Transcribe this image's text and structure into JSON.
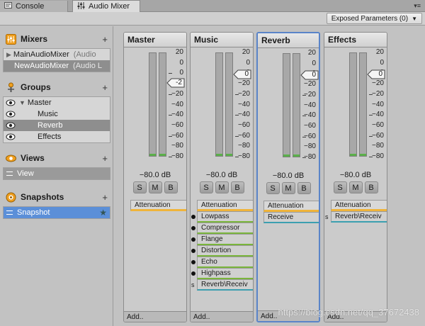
{
  "tabs": [
    {
      "label": "Console",
      "icon": "console-icon"
    },
    {
      "label": "Audio Mixer",
      "icon": "audio-mixer-icon"
    }
  ],
  "toolbar": {
    "exposed_parameters": "Exposed Parameters (0)"
  },
  "sidebar": {
    "mixers": {
      "title": "Mixers",
      "items": [
        {
          "name": "MainAudioMixer",
          "suffix": "(Audio"
        },
        {
          "name": "NewAudioMixer",
          "suffix": "(Audio L"
        }
      ]
    },
    "groups": {
      "title": "Groups",
      "items": [
        "Master",
        "Music",
        "Reverb",
        "Effects"
      ]
    },
    "views": {
      "title": "Views",
      "items": [
        "View"
      ]
    },
    "snapshots": {
      "title": "Snapshots",
      "items": [
        "Snapshot"
      ]
    }
  },
  "scale": [
    "20",
    "0",
    "−20",
    "−40",
    "−60",
    "−80"
  ],
  "scale_minor": [
    "0",
    "−20",
    "−40",
    "−60",
    "−80"
  ],
  "strips": [
    {
      "name": "Master",
      "fader": "-2",
      "db": "−80.0 dB",
      "effects": [
        {
          "label": "Attenuation",
          "color": "orange",
          "marker": ""
        }
      ],
      "add": "Add.."
    },
    {
      "name": "Music",
      "fader": "0",
      "db": "−80.0 dB",
      "effects": [
        {
          "label": "Attenuation",
          "color": "orange",
          "marker": ""
        },
        {
          "label": "Lowpass",
          "color": "green",
          "marker": "dot"
        },
        {
          "label": "Compressor",
          "color": "green",
          "marker": "dot"
        },
        {
          "label": "Flange",
          "color": "green",
          "marker": "dot"
        },
        {
          "label": "Distortion",
          "color": "green",
          "marker": "dot"
        },
        {
          "label": "Echo",
          "color": "green",
          "marker": "dot"
        },
        {
          "label": "Highpass",
          "color": "green",
          "marker": "dot"
        },
        {
          "label": "Reverb\\Receiv",
          "color": "teal",
          "marker": "s"
        }
      ],
      "add": "Add.."
    },
    {
      "name": "Reverb",
      "fader": "0",
      "db": "−80.0 dB",
      "effects": [
        {
          "label": "Attenuation",
          "color": "orange",
          "marker": ""
        },
        {
          "label": "Receive",
          "color": "teal",
          "marker": ""
        }
      ],
      "add": "Add.."
    },
    {
      "name": "Effects",
      "fader": "0",
      "db": "−80.0 dB",
      "effects": [
        {
          "label": "Attenuation",
          "color": "orange",
          "marker": ""
        },
        {
          "label": "Reverb\\Receiv",
          "color": "teal",
          "marker": "s"
        }
      ],
      "add": "Add.."
    }
  ],
  "buttons": {
    "solo": "S",
    "mute": "M",
    "bypass": "B"
  },
  "colors": {
    "accent_orange": "#f0b43a",
    "accent_green": "#7ab53c",
    "accent_teal": "#3c9fb0",
    "selection_blue": "#5b8fd8",
    "meter_green": "#5bb04a"
  },
  "watermark": "https://blog.csdn.net/qq_37672438"
}
